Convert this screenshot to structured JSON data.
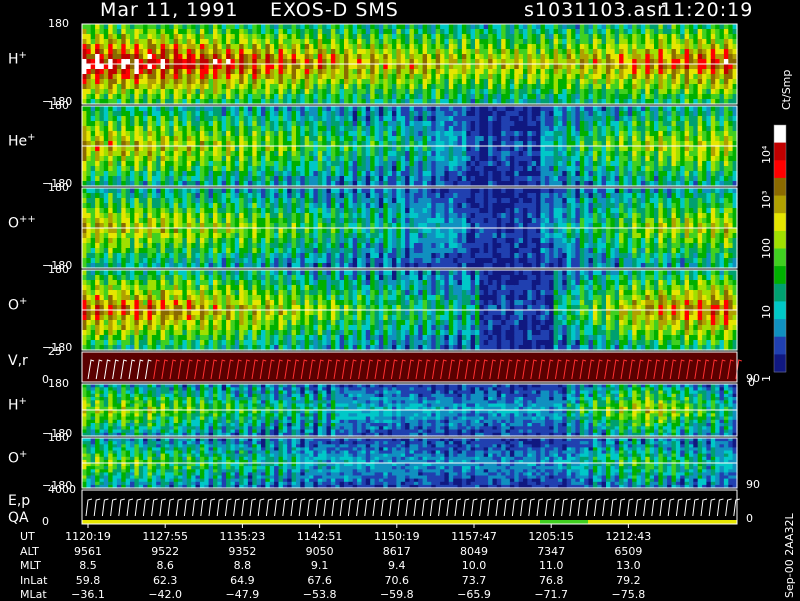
{
  "header": {
    "date": "Mar 11, 1991",
    "mission": "EXOS-D SMS",
    "file": "s1031103.asr",
    "time": "11:20:19"
  },
  "colorbar": {
    "unit": "Ct/Smp",
    "tick_labels": [
      "10⁴",
      "10³",
      "100",
      "10",
      "1"
    ],
    "colors": [
      "#ffffff",
      "#c00000",
      "#ff0000",
      "#8b6a00",
      "#b0a000",
      "#e6e600",
      "#a0e000",
      "#40d020",
      "#00b000",
      "#00a070",
      "#00c8c8",
      "#1090c0",
      "#2040b0",
      "#101880"
    ]
  },
  "chart_data": {
    "type": "heatmap",
    "title": "Mar 11, 1991   EXOS-D SMS",
    "color_scale": "log",
    "color_range": [
      1,
      10000
    ],
    "x_ticks": [
      "1120:19",
      "1127:55",
      "1135:23",
      "1142:51",
      "1150:19",
      "1157:47",
      "1205:15",
      "1212:43"
    ],
    "panels": [
      {
        "label": "H",
        "sup": "+",
        "ylim": [
          -180,
          180
        ],
        "y_ticks": [
          "180",
          "−180"
        ],
        "kind": "angle",
        "intensity": [
          3.6,
          3.4,
          3.0,
          2.6,
          2.4,
          2.3,
          2.9,
          3.2
        ],
        "gap": null
      },
      {
        "label": "He",
        "sup": "+",
        "ylim": [
          -180,
          180
        ],
        "y_ticks": [
          "180",
          "−180"
        ],
        "kind": "angle",
        "intensity": [
          2.6,
          2.3,
          1.9,
          1.3,
          0.9,
          1.0,
          2.1,
          2.3
        ],
        "gap": [
          0.58,
          0.7
        ]
      },
      {
        "label": "O",
        "sup": "++",
        "ylim": [
          -180,
          180
        ],
        "y_ticks": [
          "180",
          "−180"
        ],
        "kind": "angle",
        "intensity": [
          2.5,
          2.2,
          1.8,
          1.2,
          0.8,
          0.8,
          2.0,
          2.3
        ],
        "gap": [
          0.58,
          0.7
        ]
      },
      {
        "label": "O",
        "sup": "+",
        "ylim": [
          -180,
          180
        ],
        "y_ticks": [
          "180",
          "−180"
        ],
        "kind": "angle",
        "intensity": [
          3.0,
          2.8,
          2.3,
          1.6,
          1.1,
          1.0,
          2.7,
          3.1
        ],
        "gap": [
          0.6,
          0.72
        ]
      },
      {
        "label": "V,r",
        "sup": "",
        "ylim": [
          0,
          25
        ],
        "y_ticks": [
          "25",
          "0"
        ],
        "right_tick": "90",
        "right_tick2": "0",
        "kind": "velocity"
      },
      {
        "label": "H",
        "sup": "+",
        "ylim": [
          -180,
          180
        ],
        "y_ticks": [
          "180",
          "−180"
        ],
        "kind": "angle",
        "intensity": [
          2.1,
          1.8,
          1.3,
          0.9,
          0.8,
          0.8,
          2.4,
          1.0
        ],
        "gap": null
      },
      {
        "label": "O",
        "sup": "+",
        "ylim": [
          -180,
          180
        ],
        "y_ticks": [
          "180",
          "−180"
        ],
        "kind": "angle",
        "intensity": [
          1.9,
          1.6,
          1.1,
          0.8,
          0.7,
          0.7,
          1.6,
          0.8
        ],
        "gap": null,
        "right_tick": "90"
      },
      {
        "label": "E,p",
        "sup": "",
        "label2": "QA",
        "ylim": [
          0,
          4000
        ],
        "y_ticks": [
          "4000",
          "0"
        ],
        "right_tick": "0",
        "kind": "energy"
      }
    ],
    "ephemeris": [
      {
        "name": "UT",
        "values": [
          "1120:19",
          "1127:55",
          "1135:23",
          "1142:51",
          "1150:19",
          "1157:47",
          "1205:15",
          "1212:43"
        ]
      },
      {
        "name": "ALT",
        "values": [
          "9561",
          "9522",
          "9352",
          "9050",
          "8617",
          "8049",
          "7347",
          "6509"
        ]
      },
      {
        "name": "MLT",
        "values": [
          "8.5",
          "8.6",
          "8.8",
          "9.1",
          "9.4",
          "10.0",
          "11.0",
          "13.0"
        ]
      },
      {
        "name": "InLat",
        "values": [
          "59.8",
          "62.3",
          "64.9",
          "67.6",
          "70.6",
          "73.7",
          "76.8",
          "79.2"
        ]
      },
      {
        "name": "MLat",
        "values": [
          "−36.1",
          "−42.0",
          "−47.9",
          "−53.8",
          "−59.8",
          "−65.9",
          "−71.7",
          "−75.8"
        ]
      }
    ],
    "footer_note": "Sep-00  2AA32L"
  }
}
